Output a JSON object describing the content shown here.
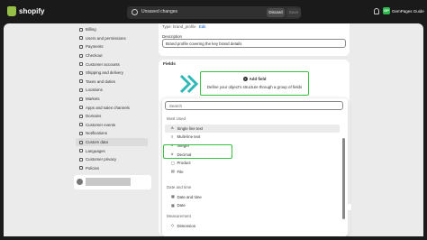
{
  "topbar": {
    "brand": "shopify",
    "unsaved_text": "Unsaved changes",
    "discard_label": "Discard",
    "save_label": "Save",
    "store_initials": "GP",
    "store_name": "GemPages Guide"
  },
  "sidebar": {
    "items": [
      {
        "label": "Billing",
        "icon": "billing-icon"
      },
      {
        "label": "Users and permissions",
        "icon": "users-icon"
      },
      {
        "label": "Payments",
        "icon": "payments-icon"
      },
      {
        "label": "Checkout",
        "icon": "checkout-icon"
      },
      {
        "label": "Customer accounts",
        "icon": "customer-accounts-icon"
      },
      {
        "label": "Shipping and delivery",
        "icon": "shipping-icon"
      },
      {
        "label": "Taxes and duties",
        "icon": "taxes-icon"
      },
      {
        "label": "Locations",
        "icon": "locations-icon"
      },
      {
        "label": "Markets",
        "icon": "markets-icon"
      },
      {
        "label": "Apps and sales channels",
        "icon": "apps-icon"
      },
      {
        "label": "Domains",
        "icon": "domains-icon"
      },
      {
        "label": "Customer events",
        "icon": "customer-events-icon"
      },
      {
        "label": "Notifications",
        "icon": "notifications-icon"
      },
      {
        "label": "Custom data",
        "icon": "custom-data-icon",
        "active": true
      },
      {
        "label": "Languages",
        "icon": "languages-icon"
      },
      {
        "label": "Customer privacy",
        "icon": "privacy-icon"
      },
      {
        "label": "Policies",
        "icon": "policies-icon"
      }
    ]
  },
  "definition": {
    "type_label": "Type:",
    "type_value": "brand_profile",
    "edit_label": "Edit",
    "description_label": "Description",
    "description_value": "Brand profile covering the key brand details"
  },
  "fields": {
    "title": "Fields",
    "add_field_label": "Add field",
    "add_field_hint": "Define your object's structure through a group of fields"
  },
  "field_menu": {
    "search_placeholder": "Search",
    "groups": [
      {
        "label": "Most Used",
        "options": [
          {
            "label": "Single line text",
            "icon": "A",
            "highlighted": true
          },
          {
            "label": "Multi-line text",
            "icon": "≡"
          },
          {
            "label": "Integer",
            "icon": "#"
          },
          {
            "label": "Decimal",
            "icon": "#"
          },
          {
            "label": "Product",
            "icon": "▢"
          },
          {
            "label": "File",
            "icon": "▤"
          }
        ]
      },
      {
        "label": "Date and time",
        "options": [
          {
            "label": "Date and time",
            "icon": "▦"
          },
          {
            "label": "Date",
            "icon": "▦"
          }
        ]
      },
      {
        "label": "Measurement",
        "options": [
          {
            "label": "Dimension",
            "icon": "◇"
          }
        ]
      }
    ]
  },
  "colors": {
    "highlight_box": "#35c43d",
    "chevron": "#2fb8b8",
    "accent_link": "#005bd3"
  }
}
